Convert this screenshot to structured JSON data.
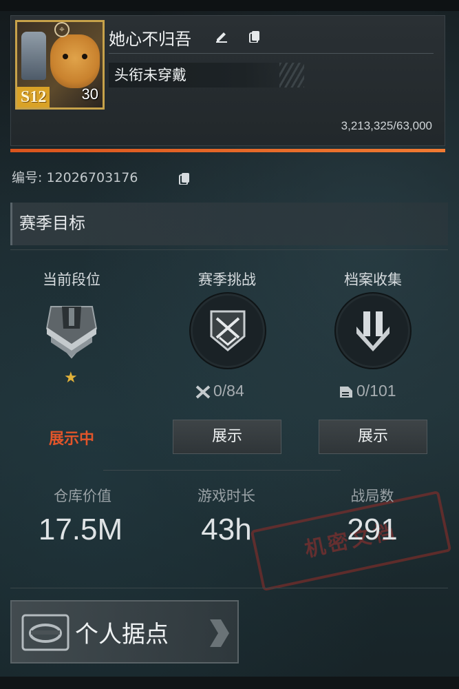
{
  "profile": {
    "name": "她心不归吾",
    "title": "头衔未穿戴",
    "season_badge": "S12",
    "level": "30",
    "exp": "3,213,325/63,000",
    "id_label": "编号:",
    "id_value": "12026703176"
  },
  "season_goal": {
    "heading": "赛季目标"
  },
  "columns": {
    "rank": {
      "label": "当前段位",
      "status": "展示中"
    },
    "challenge": {
      "label": "赛季挑战",
      "count": "0/84",
      "button": "展示",
      "icon": "crossed-rifles-icon"
    },
    "archive": {
      "label": "档案收集",
      "count": "0/101",
      "button": "展示",
      "icon": "chevron-emblem-icon"
    }
  },
  "metrics": [
    {
      "label": "仓库价值",
      "value": "17.5M"
    },
    {
      "label": "游戏时长",
      "value": "43h"
    },
    {
      "label": "战局数",
      "value": "291"
    }
  ],
  "stamp_text": "机密文档",
  "base": {
    "label": "个人据点"
  },
  "colors": {
    "accent": "#e2552a",
    "star": "#e2b23a",
    "badge": "#d9a227"
  }
}
